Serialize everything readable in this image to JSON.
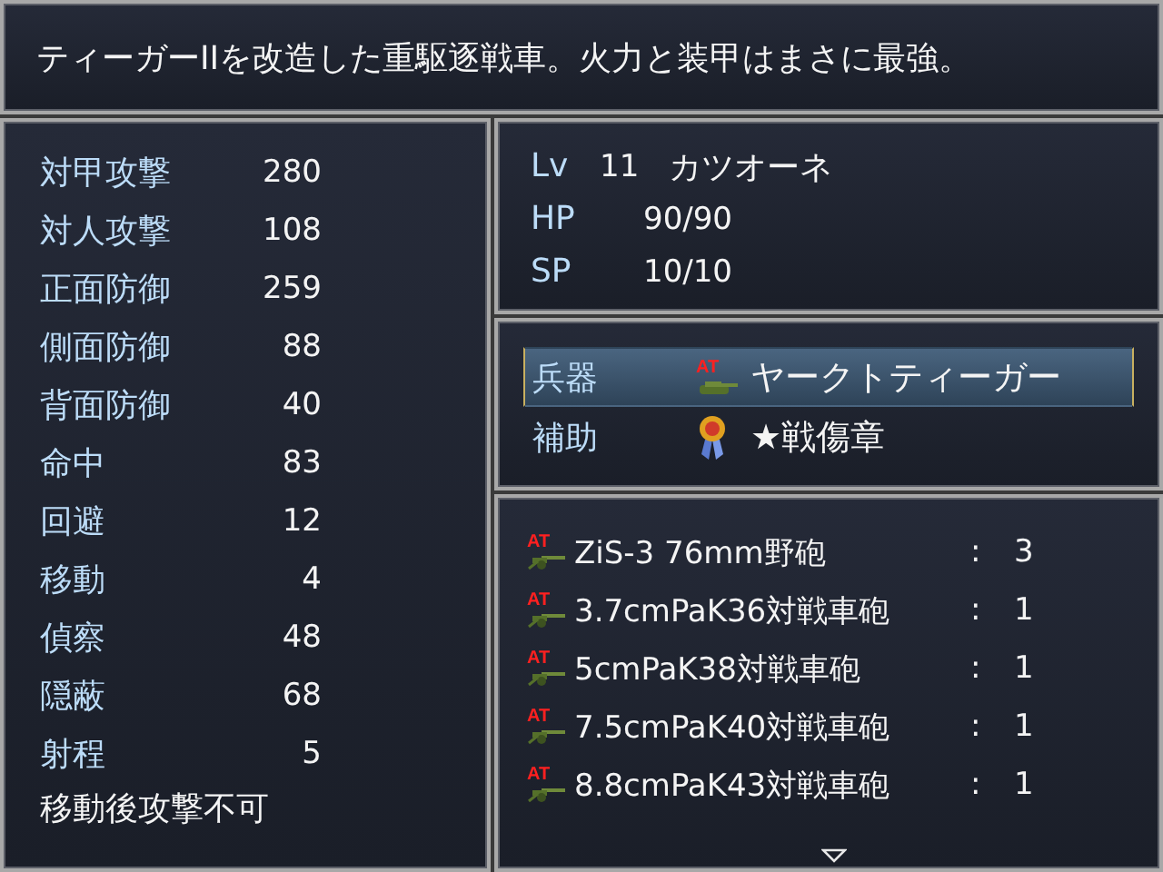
{
  "description": "ティーガーIIを改造した重駆逐戦車。火力と装甲はまさに最強。",
  "stats": [
    {
      "label": "対甲攻撃",
      "value": "280"
    },
    {
      "label": "対人攻撃",
      "value": "108"
    },
    {
      "label": "正面防御",
      "value": "259"
    },
    {
      "label": "側面防御",
      "value": "88"
    },
    {
      "label": "背面防御",
      "value": "40"
    },
    {
      "label": "命中",
      "value": "83"
    },
    {
      "label": "回避",
      "value": "12"
    },
    {
      "label": "移動",
      "value": "4"
    },
    {
      "label": "偵察",
      "value": "48"
    },
    {
      "label": "隠蔽",
      "value": "68"
    },
    {
      "label": "射程",
      "value": "5"
    }
  ],
  "note": "移動後攻撃不可",
  "unit": {
    "level_label": "Lv",
    "level": "11",
    "name": "カツオーネ",
    "hp_label": "HP",
    "hp": "90/90",
    "sp_label": "SP",
    "sp": "10/10"
  },
  "equipment": [
    {
      "slot": "兵器",
      "kind": "tank",
      "badge": "AT",
      "item": "ヤークトティーガー",
      "selected": true
    },
    {
      "slot": "補助",
      "kind": "medal",
      "item": "★戦傷章",
      "selected": false
    }
  ],
  "weapons": [
    {
      "kind": "gun",
      "badge": "AT",
      "name": "ZiS-3  76mm野砲",
      "separator": ":",
      "count": "3"
    },
    {
      "kind": "gun",
      "badge": "AT",
      "name": "3.7cmPaK36対戦車砲",
      "separator": ":",
      "count": "1"
    },
    {
      "kind": "gun",
      "badge": "AT",
      "name": "5cmPaK38対戦車砲",
      "separator": ":",
      "count": "1"
    },
    {
      "kind": "gun",
      "badge": "AT",
      "name": "7.5cmPaK40対戦車砲",
      "separator": ":",
      "count": "1"
    },
    {
      "kind": "gun",
      "badge": "AT",
      "name": "8.8cmPaK43対戦車砲",
      "separator": ":",
      "count": "1"
    }
  ],
  "more_below": true
}
